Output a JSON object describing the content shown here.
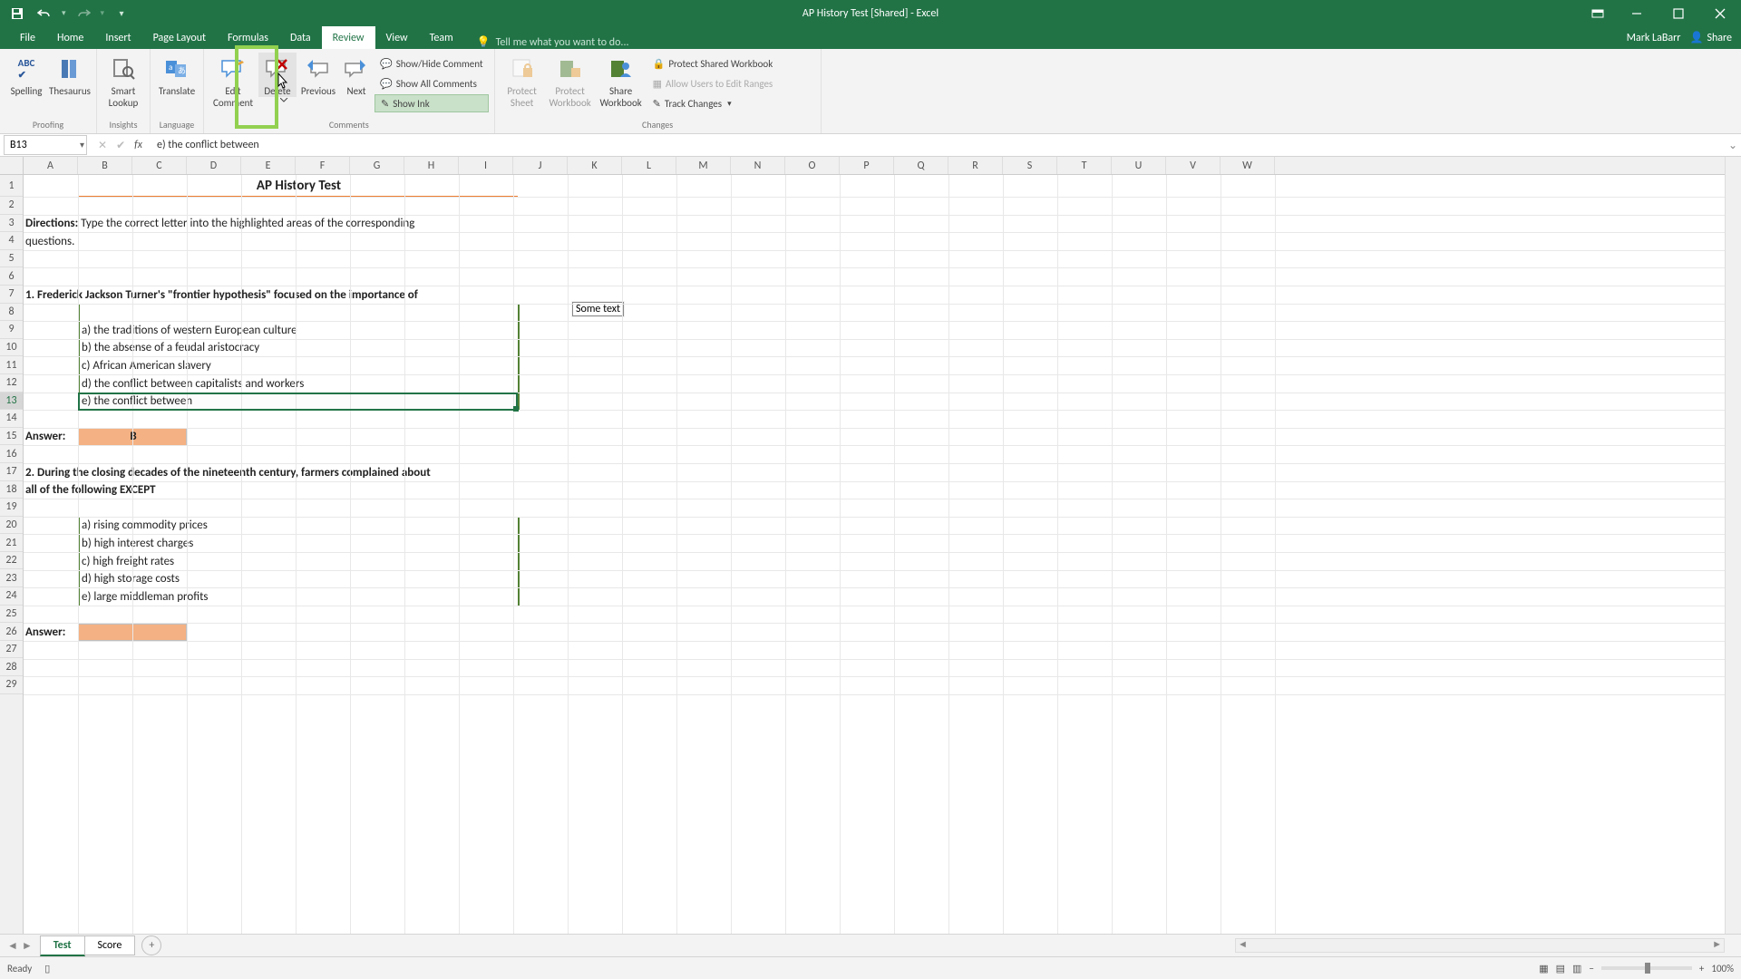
{
  "title": "AP History Test  [Shared] - Excel",
  "user": "Mark LaBarr",
  "shareLabel": "Share",
  "tabs": {
    "file": "File",
    "home": "Home",
    "insert": "Insert",
    "pageLayout": "Page Layout",
    "formulas": "Formulas",
    "data": "Data",
    "review": "Review",
    "view": "View",
    "team": "Team"
  },
  "tellMe": "Tell me what you want to do...",
  "ribbon": {
    "proofing": {
      "spelling": "Spelling",
      "thesaurus": "Thesaurus",
      "label": "Proofing"
    },
    "insights": {
      "smartLookup": "Smart\nLookup",
      "label": "Insights"
    },
    "language": {
      "translate": "Translate",
      "label": "Language"
    },
    "comments": {
      "edit": "Edit\nComment",
      "delete": "Delete",
      "previous": "Previous",
      "next": "Next",
      "showHide": "Show/Hide Comment",
      "showAll": "Show All Comments",
      "showInk": "Show Ink",
      "label": "Comments"
    },
    "changes": {
      "protectSheet": "Protect\nSheet",
      "protectWorkbook": "Protect\nWorkbook",
      "shareWorkbook": "Share\nWorkbook",
      "protectShared": "Protect Shared Workbook",
      "allowEdit": "Allow Users to Edit Ranges",
      "trackChanges": "Track Changes",
      "label": "Changes"
    }
  },
  "nameBox": "B13",
  "formula": "e) the conflict between",
  "columns": [
    "A",
    "B",
    "C",
    "D",
    "E",
    "F",
    "G",
    "H",
    "I",
    "J",
    "K",
    "L",
    "M",
    "N",
    "O",
    "P",
    "Q",
    "R",
    "S",
    "T",
    "U",
    "V",
    "W"
  ],
  "rows": [
    "1",
    "2",
    "3",
    "4",
    "5",
    "6",
    "7",
    "8",
    "9",
    "10",
    "11",
    "12",
    "13",
    "14",
    "15",
    "16",
    "17",
    "18",
    "19",
    "20",
    "21",
    "22",
    "23",
    "24",
    "25",
    "26",
    "27",
    "28",
    "29"
  ],
  "content": {
    "titleCell": "AP History Test",
    "directionsLabel": "Directions:",
    "directionsText": "Type the correct letter into the highlighted areas of the corresponding",
    "directionsText2": "questions.",
    "q1": "1. Frederick Jackson Turner's \"frontier hypothesis\" focused on the importance of",
    "q1a": "a) the traditions of western European culture",
    "q1b": "b) the absense of a feudal aristocracy",
    "q1c": "c) African American slavery",
    "q1d": "d) the conflict between capitalists and workers",
    "q1e": "e) the conflict between",
    "answerLabel": "Answer:",
    "answer1": "B",
    "q2a_line1": "2. During the closing decades of the nineteenth century, farmers complained about",
    "q2a_line2": "all of the following EXCEPT",
    "q2a": "a) rising commodity prices",
    "q2b": "b) high interest charges",
    "q2c": "c) high freight rates",
    "q2d": "d) high storage costs",
    "q2e": "e) large middleman profits",
    "answer2": "",
    "commentText": "Some text"
  },
  "sheets": {
    "test": "Test",
    "score": "Score"
  },
  "status": {
    "ready": "Ready",
    "zoom": "100%"
  }
}
